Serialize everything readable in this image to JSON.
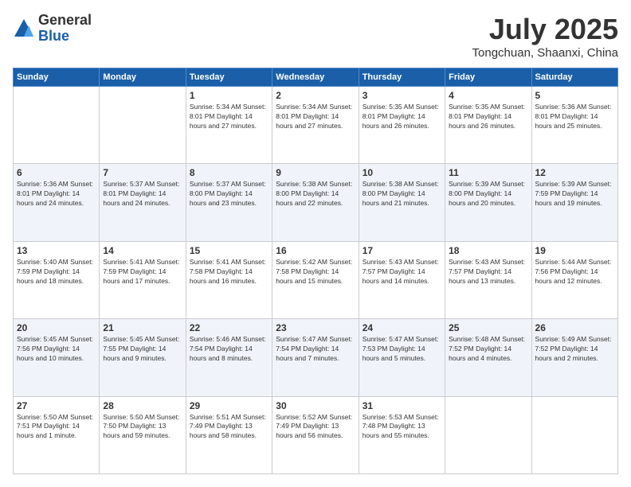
{
  "logo": {
    "general": "General",
    "blue": "Blue"
  },
  "header": {
    "month": "July 2025",
    "location": "Tongchuan, Shaanxi, China"
  },
  "weekdays": [
    "Sunday",
    "Monday",
    "Tuesday",
    "Wednesday",
    "Thursday",
    "Friday",
    "Saturday"
  ],
  "weeks": [
    [
      {
        "day": "",
        "info": ""
      },
      {
        "day": "",
        "info": ""
      },
      {
        "day": "1",
        "info": "Sunrise: 5:34 AM\nSunset: 8:01 PM\nDaylight: 14 hours\nand 27 minutes."
      },
      {
        "day": "2",
        "info": "Sunrise: 5:34 AM\nSunset: 8:01 PM\nDaylight: 14 hours\nand 27 minutes."
      },
      {
        "day": "3",
        "info": "Sunrise: 5:35 AM\nSunset: 8:01 PM\nDaylight: 14 hours\nand 26 minutes."
      },
      {
        "day": "4",
        "info": "Sunrise: 5:35 AM\nSunset: 8:01 PM\nDaylight: 14 hours\nand 26 minutes."
      },
      {
        "day": "5",
        "info": "Sunrise: 5:36 AM\nSunset: 8:01 PM\nDaylight: 14 hours\nand 25 minutes."
      }
    ],
    [
      {
        "day": "6",
        "info": "Sunrise: 5:36 AM\nSunset: 8:01 PM\nDaylight: 14 hours\nand 24 minutes."
      },
      {
        "day": "7",
        "info": "Sunrise: 5:37 AM\nSunset: 8:01 PM\nDaylight: 14 hours\nand 24 minutes."
      },
      {
        "day": "8",
        "info": "Sunrise: 5:37 AM\nSunset: 8:00 PM\nDaylight: 14 hours\nand 23 minutes."
      },
      {
        "day": "9",
        "info": "Sunrise: 5:38 AM\nSunset: 8:00 PM\nDaylight: 14 hours\nand 22 minutes."
      },
      {
        "day": "10",
        "info": "Sunrise: 5:38 AM\nSunset: 8:00 PM\nDaylight: 14 hours\nand 21 minutes."
      },
      {
        "day": "11",
        "info": "Sunrise: 5:39 AM\nSunset: 8:00 PM\nDaylight: 14 hours\nand 20 minutes."
      },
      {
        "day": "12",
        "info": "Sunrise: 5:39 AM\nSunset: 7:59 PM\nDaylight: 14 hours\nand 19 minutes."
      }
    ],
    [
      {
        "day": "13",
        "info": "Sunrise: 5:40 AM\nSunset: 7:59 PM\nDaylight: 14 hours\nand 18 minutes."
      },
      {
        "day": "14",
        "info": "Sunrise: 5:41 AM\nSunset: 7:59 PM\nDaylight: 14 hours\nand 17 minutes."
      },
      {
        "day": "15",
        "info": "Sunrise: 5:41 AM\nSunset: 7:58 PM\nDaylight: 14 hours\nand 16 minutes."
      },
      {
        "day": "16",
        "info": "Sunrise: 5:42 AM\nSunset: 7:58 PM\nDaylight: 14 hours\nand 15 minutes."
      },
      {
        "day": "17",
        "info": "Sunrise: 5:43 AM\nSunset: 7:57 PM\nDaylight: 14 hours\nand 14 minutes."
      },
      {
        "day": "18",
        "info": "Sunrise: 5:43 AM\nSunset: 7:57 PM\nDaylight: 14 hours\nand 13 minutes."
      },
      {
        "day": "19",
        "info": "Sunrise: 5:44 AM\nSunset: 7:56 PM\nDaylight: 14 hours\nand 12 minutes."
      }
    ],
    [
      {
        "day": "20",
        "info": "Sunrise: 5:45 AM\nSunset: 7:56 PM\nDaylight: 14 hours\nand 10 minutes."
      },
      {
        "day": "21",
        "info": "Sunrise: 5:45 AM\nSunset: 7:55 PM\nDaylight: 14 hours\nand 9 minutes."
      },
      {
        "day": "22",
        "info": "Sunrise: 5:46 AM\nSunset: 7:54 PM\nDaylight: 14 hours\nand 8 minutes."
      },
      {
        "day": "23",
        "info": "Sunrise: 5:47 AM\nSunset: 7:54 PM\nDaylight: 14 hours\nand 7 minutes."
      },
      {
        "day": "24",
        "info": "Sunrise: 5:47 AM\nSunset: 7:53 PM\nDaylight: 14 hours\nand 5 minutes."
      },
      {
        "day": "25",
        "info": "Sunrise: 5:48 AM\nSunset: 7:52 PM\nDaylight: 14 hours\nand 4 minutes."
      },
      {
        "day": "26",
        "info": "Sunrise: 5:49 AM\nSunset: 7:52 PM\nDaylight: 14 hours\nand 2 minutes."
      }
    ],
    [
      {
        "day": "27",
        "info": "Sunrise: 5:50 AM\nSunset: 7:51 PM\nDaylight: 14 hours\nand 1 minute."
      },
      {
        "day": "28",
        "info": "Sunrise: 5:50 AM\nSunset: 7:50 PM\nDaylight: 13 hours\nand 59 minutes."
      },
      {
        "day": "29",
        "info": "Sunrise: 5:51 AM\nSunset: 7:49 PM\nDaylight: 13 hours\nand 58 minutes."
      },
      {
        "day": "30",
        "info": "Sunrise: 5:52 AM\nSunset: 7:49 PM\nDaylight: 13 hours\nand 56 minutes."
      },
      {
        "day": "31",
        "info": "Sunrise: 5:53 AM\nSunset: 7:48 PM\nDaylight: 13 hours\nand 55 minutes."
      },
      {
        "day": "",
        "info": ""
      },
      {
        "day": "",
        "info": ""
      }
    ]
  ]
}
